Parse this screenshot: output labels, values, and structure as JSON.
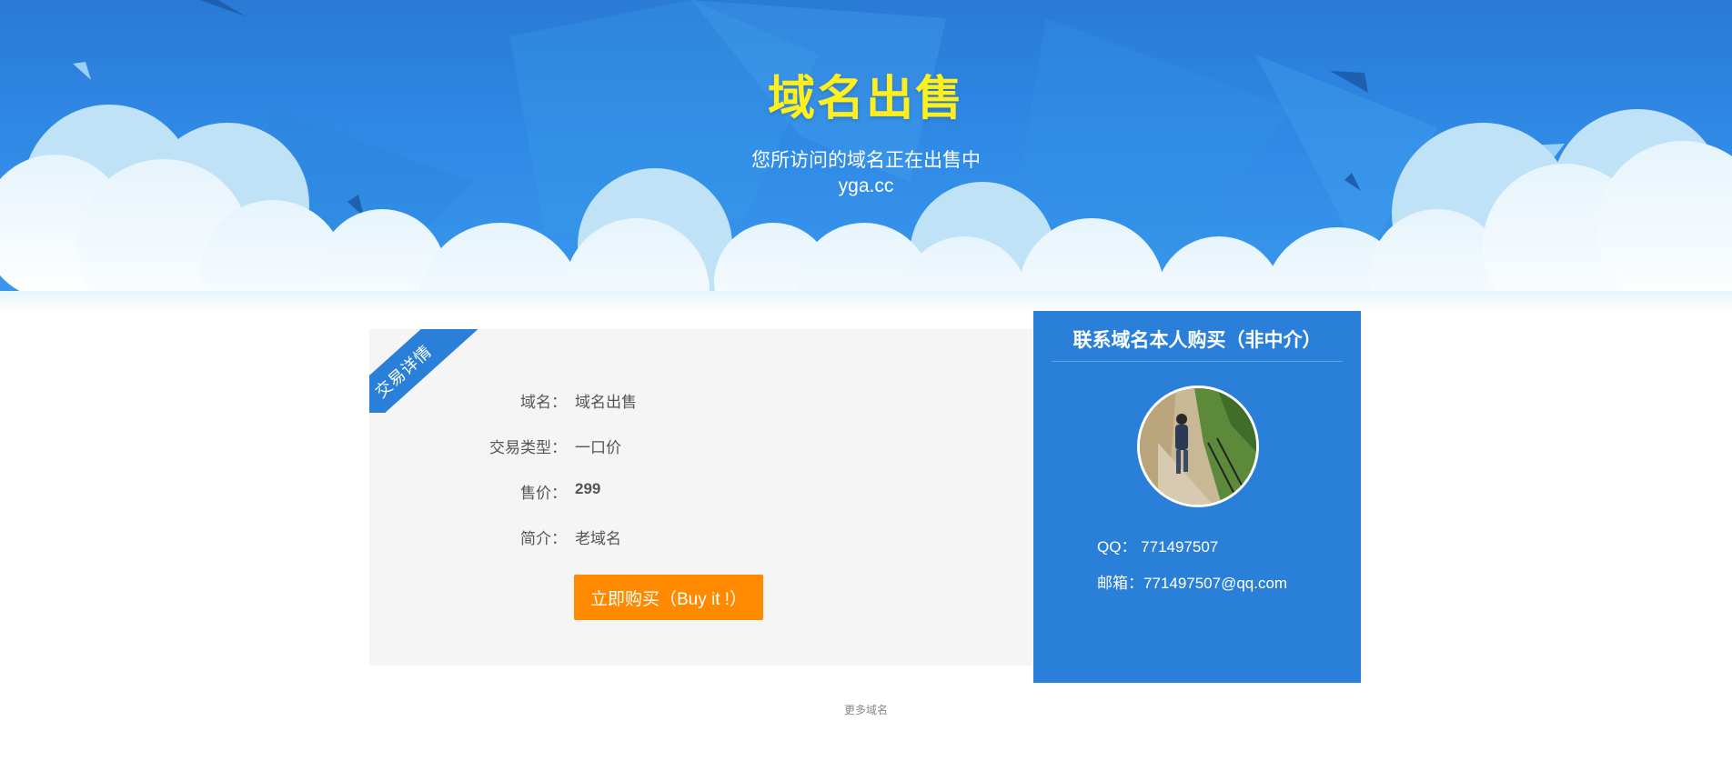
{
  "hero": {
    "title": "域名出售",
    "subtitle": "您所访问的域名正在出售中",
    "domain": "yga.cc",
    "title_color": "#ffef1c",
    "background_color": "#2f8ae6"
  },
  "detail": {
    "ribbon": "交易详情",
    "fields": [
      {
        "label": "域名：",
        "value": "域名出售"
      },
      {
        "label": "交易类型：",
        "value": "一口价"
      },
      {
        "label": "售价：",
        "value": "299"
      },
      {
        "label": "简介：",
        "value": "老域名"
      }
    ],
    "buy_button": "立即购买（Buy it !）",
    "button_color": "#ff8a00"
  },
  "contact": {
    "title": "联系域名本人购买（非中介）",
    "qq": "QQ：  771497507",
    "email": "邮箱：771497507@qq.com",
    "avatar_icon": "person-walking-photo",
    "panel_color": "#2a7fd8"
  },
  "footer": {
    "more_link": "更多域名"
  }
}
